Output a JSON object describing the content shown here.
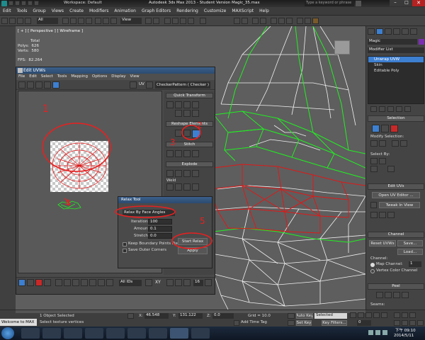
{
  "app": {
    "workspace_label": "Workspace: Default",
    "window_title": "Autodesk 3ds Max 2013 - Student Version  Magic_35.max",
    "search_placeholder": "Type a keyword or phrase"
  },
  "menubar": [
    "Edit",
    "Tools",
    "Group",
    "Views",
    "Create",
    "Modifiers",
    "Animation",
    "Graph Editors",
    "Rendering",
    "Customize",
    "MAXScript",
    "Help"
  ],
  "toolbar": {
    "selection_filter": "All",
    "ref_coord": "View"
  },
  "viewport": {
    "label": "[ + ] [ Perspective ] [ Wireframe ]",
    "stats": {
      "total_label": "Total",
      "polys_label": "Polys:",
      "polys_value": "626",
      "verts_label": "Verts:",
      "verts_value": "580",
      "fps_label": "FPS:",
      "fps_value": "82.264"
    }
  },
  "command_panel": {
    "object_name": "Magic",
    "modifier_list_label": "Modifier List",
    "stack": [
      "Unwrap UVW",
      "Skin",
      "Editable Poly"
    ],
    "selection": {
      "header": "Selection",
      "modify_selection": "Modify Selection:",
      "select_by": "Select By:"
    },
    "edit_uvs": {
      "header": "Edit UVs",
      "open_editor": "Open UV Editor ...",
      "tweak": "Tweak In View"
    },
    "channel": {
      "header": "Channel",
      "reset_uvws": "Reset UVWs",
      "save": "Save...",
      "load": "Load...",
      "channel_label": "Channel:",
      "map_channel_label": "Map Channel:",
      "map_channel_value": "1",
      "vertex_color": "Vertex Color Channel"
    },
    "peel": {
      "header": "Peel",
      "seams": "Seams:"
    }
  },
  "uvw_window": {
    "title": "Edit UVWs",
    "menu": [
      "File",
      "Edit",
      "Select",
      "Tools",
      "Mapping",
      "Options",
      "Display",
      "View"
    ],
    "uv_label": "UV",
    "checker": "CheckerPattern  ( Checker )",
    "quick_transform": "Quick Transform",
    "reshape_elements": "Reshape Elements",
    "stitch": "Stitch",
    "explode": "Explode",
    "weld": "Weld",
    "all_ids": "All IDs",
    "xy_label": "XY",
    "zoom_value": "16"
  },
  "annotations": [
    "1",
    "2",
    "3",
    "4",
    "5"
  ],
  "relax_dialog": {
    "title": "Relax Tool",
    "method": "Relax By Face Angles",
    "iterations_label": "Iterations:",
    "iterations_value": "100",
    "amount_label": "Amount:",
    "amount_value": "0.1",
    "stretch_label": "Stretch:",
    "stretch_value": "0.0",
    "keep_boundary": "Keep Boundary Points Fixed",
    "save_outer": "Save Outer Corners",
    "start_relax": "Start Relax",
    "apply": "Apply"
  },
  "status": {
    "welcome": "Welcome to MAX",
    "objects_selected": "1 Object Selected",
    "prompt": "Select texture vertices",
    "x_label": "X:",
    "x_value": "46.548",
    "y_label": "Y:",
    "y_value": "131.122",
    "z_label": "Z:",
    "z_value": "0.0",
    "grid": "Grid = 10.0",
    "auto_key": "Auto Key",
    "selected": "Selected",
    "add_time_tag": "Add Time Tag",
    "set_key": "Set Key",
    "key_filters": "Key Filters...",
    "frame_value": "0"
  },
  "taskbar": {
    "time": "下午 09:10",
    "date": "2014/5/11"
  },
  "colors": {
    "uv_red": "#e01818",
    "mesh_green": "#22ee22",
    "mesh_white": "#f2f2f2",
    "annotation_red": "#e82020",
    "selected_blue": "#3d7fd0"
  }
}
